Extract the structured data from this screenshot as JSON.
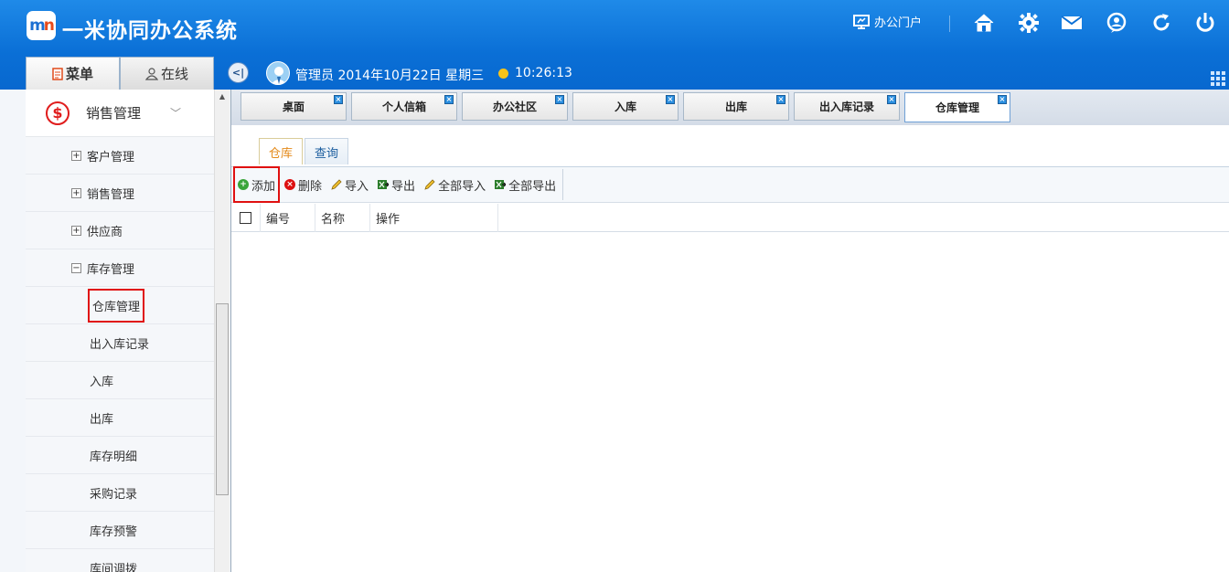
{
  "app": {
    "title": "一米协同办公系统",
    "logo_text": "m",
    "logo_text2": "n"
  },
  "header": {
    "portal_label": "办公门户",
    "icons": [
      "home-icon",
      "gear-icon",
      "mail-icon",
      "user-status-icon",
      "refresh-icon",
      "power-icon"
    ]
  },
  "left_tabs": [
    {
      "label": "菜单",
      "icon": "document-icon",
      "active": true
    },
    {
      "label": "在线",
      "icon": "person-icon",
      "active": false
    }
  ],
  "user": {
    "info": "管理员 2014年10月22日 星期三",
    "time": "10:26:13"
  },
  "sidebar": {
    "group": {
      "label": "销售管理",
      "icon": "dollar-icon"
    },
    "items": [
      {
        "label": "客户管理",
        "level": 1,
        "toggle": "+"
      },
      {
        "label": "销售管理",
        "level": 1,
        "toggle": "+"
      },
      {
        "label": "供应商",
        "level": 1,
        "toggle": "+"
      },
      {
        "label": "库存管理",
        "level": 1,
        "toggle": "−"
      },
      {
        "label": "仓库管理",
        "level": 2
      },
      {
        "label": "出入库记录",
        "level": 2
      },
      {
        "label": "入库",
        "level": 2
      },
      {
        "label": "出库",
        "level": 2
      },
      {
        "label": "库存明细",
        "level": 2
      },
      {
        "label": "采购记录",
        "level": 2
      },
      {
        "label": "库存预警",
        "level": 2
      },
      {
        "label": "库间调拨",
        "level": 2
      }
    ]
  },
  "main_tabs": [
    {
      "label": "桌面"
    },
    {
      "label": "个人信箱"
    },
    {
      "label": "办公社区"
    },
    {
      "label": "入库"
    },
    {
      "label": "出库"
    },
    {
      "label": "出入库记录"
    },
    {
      "label": "仓库管理",
      "active": true
    }
  ],
  "sub_tabs": [
    {
      "label": "仓库",
      "active": true
    },
    {
      "label": "查询"
    }
  ],
  "toolbar": {
    "add": "添加",
    "delete": "删除",
    "import": "导入",
    "export": "导出",
    "import_all": "全部导入",
    "export_all": "全部导出"
  },
  "table": {
    "columns": [
      "编号",
      "名称",
      "操作"
    ],
    "rows": []
  },
  "colors": {
    "header_blue": "#0a6fd6",
    "highlight_red": "#e01010",
    "active_subtab": "#e48a1a"
  }
}
